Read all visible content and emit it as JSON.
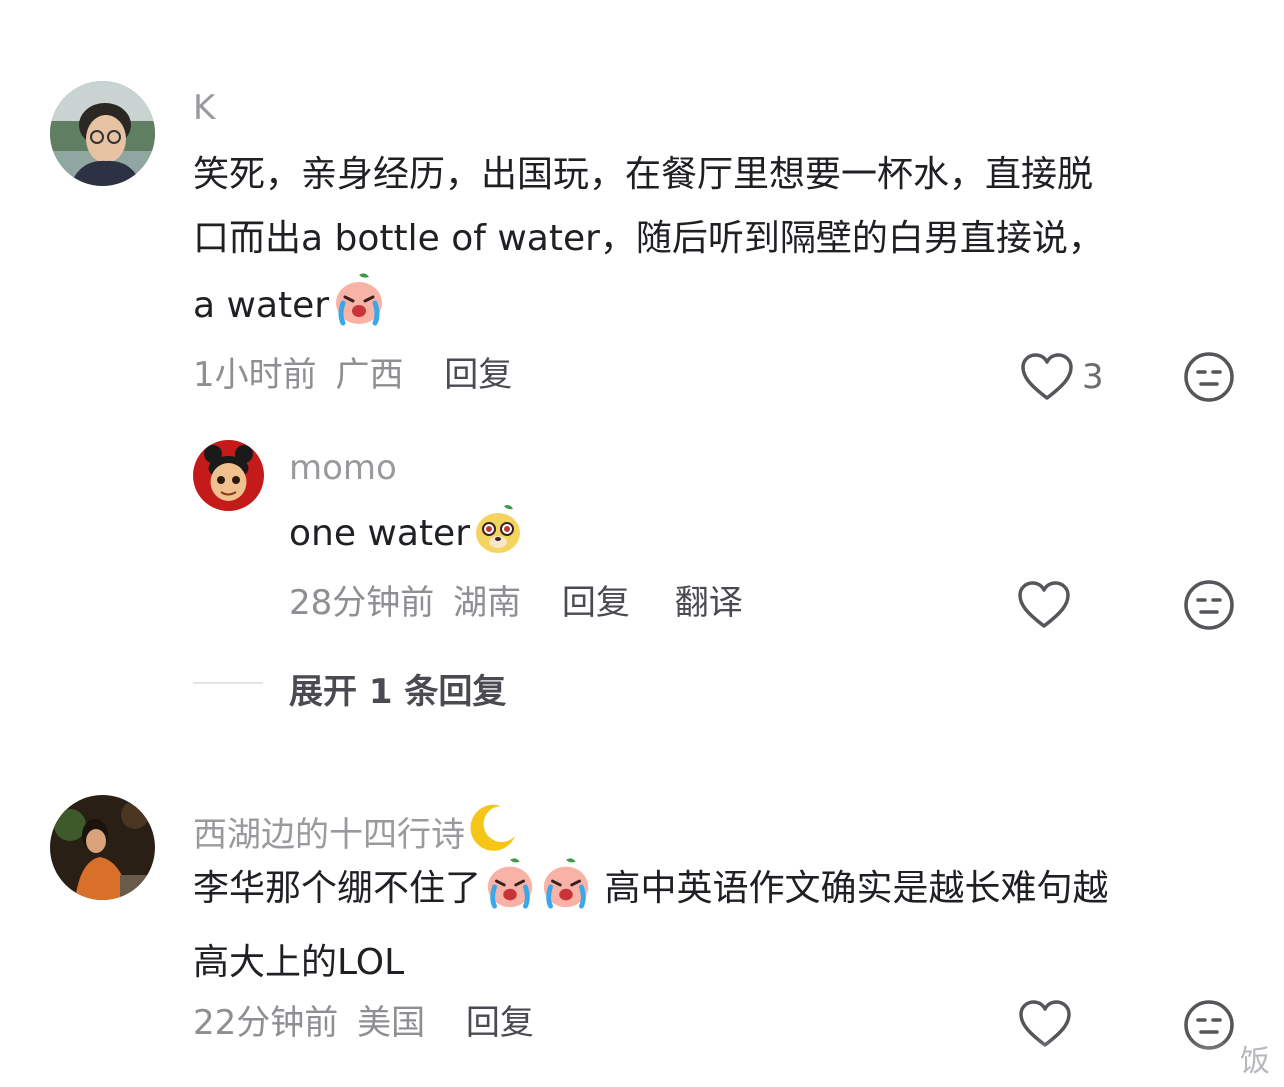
{
  "comments": [
    {
      "username": "K",
      "text_line1": "笑死，亲身经历，出国玩，在餐厅里想要一杯水，直接脱",
      "text_line2": "口而出a bottle of water，随后听到隔壁的白男直接说，",
      "text_line3": "a water",
      "emoji": "crying-peach-emoji",
      "time": "1小时前",
      "location": "广西",
      "reply_label": "回复",
      "like_count": "3"
    },
    {
      "username": "西湖边的十四行诗",
      "name_emoji": "crescent-moon-emoji",
      "text_line1a": "李华那个绷不住了",
      "text_line1b": "高中英语作文确实是越长难句越",
      "text_line2": "高大上的LOL",
      "emojis": [
        "crying-peach-emoji",
        "crying-peach-emoji"
      ],
      "time": "22分钟前",
      "location": "美国",
      "reply_label": "回复"
    }
  ],
  "reply": {
    "username": "momo",
    "text": "one water",
    "emoji": "dog-face-emoji",
    "time": "28分钟前",
    "location": "湖南",
    "reply_label": "回复",
    "translate_label": "翻译"
  },
  "expand_replies_label": "展开 1 条回复",
  "watermark_text": "饭"
}
